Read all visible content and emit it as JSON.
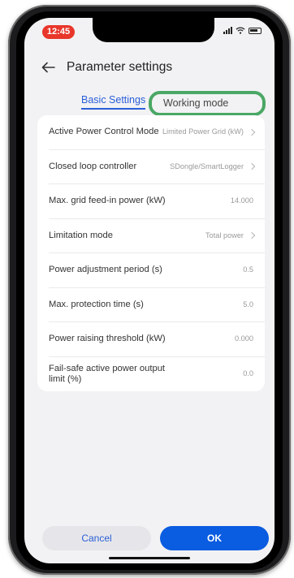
{
  "status_bar": {
    "time": "12:45"
  },
  "header": {
    "title": "Parameter settings"
  },
  "tabs": [
    {
      "label": "Basic Settings",
      "active": true
    },
    {
      "label": "Working mode",
      "highlighted": true,
      "highlight_color": "#4aa765"
    }
  ],
  "settings": [
    {
      "label": "Active Power Control Mode",
      "value": "Limited Power Grid (kW)",
      "chevron": true
    },
    {
      "label": "Closed loop controller",
      "value": "SDongle/SmartLogger",
      "chevron": true
    },
    {
      "label": "Max. grid feed-in power (kW)",
      "value": "14.000",
      "chevron": false
    },
    {
      "label": "Limitation mode",
      "value": "Total power",
      "chevron": true
    },
    {
      "label": "Power adjustment period (s)",
      "value": "0.5",
      "chevron": false
    },
    {
      "label": "Max. protection time (s)",
      "value": "5.0",
      "chevron": false
    },
    {
      "label": "Power raising threshold (kW)",
      "value": "0.000",
      "chevron": false
    },
    {
      "label": "Fail-safe active power output limit (%)",
      "value": "0.0",
      "chevron": false
    }
  ],
  "footer": {
    "cancel_label": "Cancel",
    "ok_label": "OK"
  },
  "colors": {
    "accent": "#2a5fd8",
    "primary_button": "#0a5ce0",
    "status_time_bg": "#e8362b"
  }
}
